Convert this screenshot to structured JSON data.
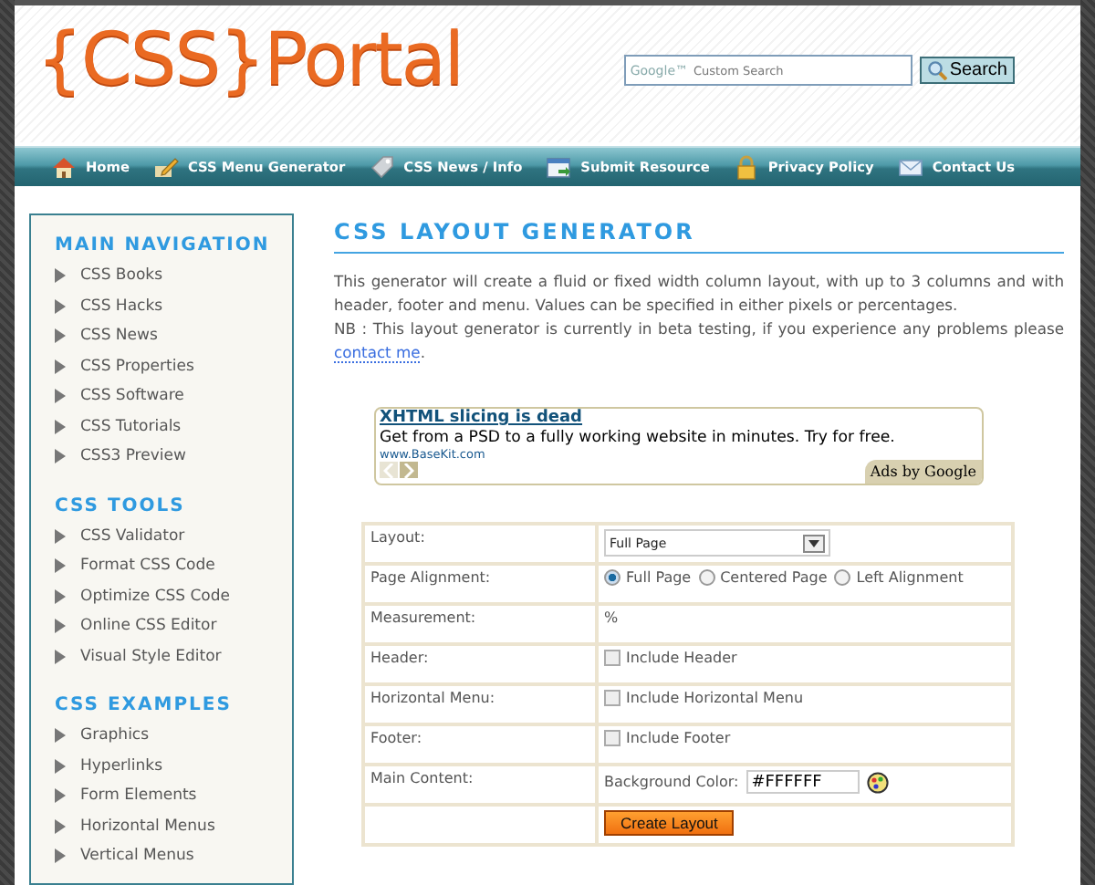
{
  "header": {
    "logo": "{CSS}Portal",
    "search": {
      "brand": "Google™",
      "placeholder": "Custom Search",
      "button": "Search"
    }
  },
  "nav": [
    {
      "label": "Home"
    },
    {
      "label": "CSS Menu Generator"
    },
    {
      "label": "CSS News / Info"
    },
    {
      "label": "Submit Resource"
    },
    {
      "label": "Privacy Policy"
    },
    {
      "label": "Contact Us"
    }
  ],
  "sidebar": [
    {
      "heading": "MAIN NAVIGATION",
      "items": [
        "CSS Books",
        "CSS Hacks",
        "CSS News",
        "CSS Properties",
        "CSS Software",
        "CSS Tutorials",
        "CSS3 Preview"
      ]
    },
    {
      "heading": "CSS TOOLS",
      "items": [
        "CSS Validator",
        "Format CSS Code",
        "Optimize CSS Code",
        "Online CSS Editor",
        "Visual Style Editor"
      ]
    },
    {
      "heading": "CSS EXAMPLES",
      "items": [
        "Graphics",
        "Hyperlinks",
        "Form Elements",
        "Horizontal Menus",
        "Vertical Menus"
      ]
    }
  ],
  "main": {
    "title": "CSS LAYOUT GENERATOR",
    "intro": "This generator will create a fluid or fixed width column layout, with up to 3 columns and with header, footer and menu. Values can be specified in either pixels or percentages.",
    "note": "NB : This layout generator is currently in beta testing, if you experience any problems please",
    "note_link": "contact me",
    "note_end": ".",
    "ad": {
      "title": "XHTML slicing is dead",
      "text": "Get from a PSD to a fully working website in minutes. Try for free.",
      "url": "www.BaseKit.com",
      "badge": "Ads by Google"
    },
    "form": [
      {
        "label": "Layout:",
        "kind": "select",
        "value": "Full Page"
      },
      {
        "label": "Page Alignment:",
        "kind": "radio",
        "options": [
          {
            "label": "Full Page",
            "selected": true
          },
          {
            "label": "Centered Page",
            "selected": false
          },
          {
            "label": "Left Alignment",
            "selected": false
          }
        ]
      },
      {
        "label": "Measurement:",
        "kind": "text",
        "text": "%"
      },
      {
        "label": "Header:",
        "kind": "checkbox",
        "option": "Include Header",
        "checked": false
      },
      {
        "label": "Horizontal Menu:",
        "kind": "checkbox",
        "option": "Include Horizontal Menu",
        "checked": false
      },
      {
        "label": "Footer:",
        "kind": "checkbox",
        "option": "Include Footer",
        "checked": false
      },
      {
        "label": "Main Content:",
        "kind": "color",
        "caption": "Background Color:",
        "value": "#FFFFFF"
      },
      {
        "kind": "button",
        "button": "Create Layout"
      }
    ]
  }
}
